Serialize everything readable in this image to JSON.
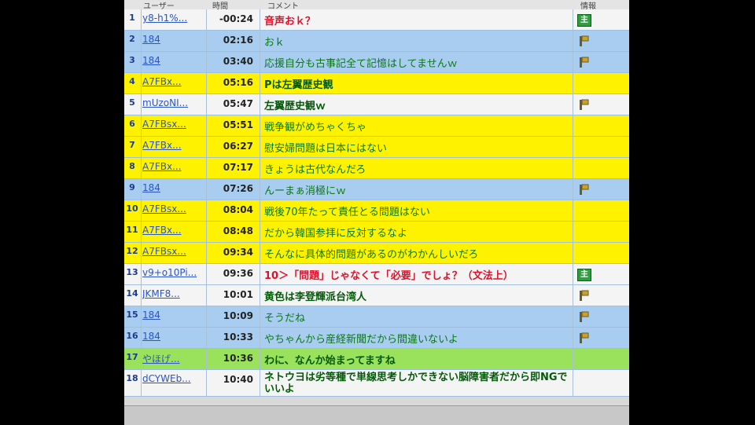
{
  "header": {
    "col_user": "ユーザー",
    "col_time": "時間",
    "col_comment": "コメント",
    "col_info": "情報"
  },
  "colors": {
    "row_white": "#f4f4f4",
    "row_blue": "#a9cdf1",
    "row_yellow": "#fff200",
    "row_green": "#9be25c",
    "text_red": "#e0102a",
    "text_green": "#0a7a12",
    "text_darkgreen": "#055a0a"
  },
  "comments": [
    {
      "num": "1",
      "user": "y8-h1%...",
      "time": "-00:24",
      "text": "音声おｋ？",
      "bg": "white",
      "color": "red",
      "icon": "owner"
    },
    {
      "num": "2",
      "user": "184",
      "time": "02:16",
      "text": "おｋ",
      "bg": "blue",
      "color": "green",
      "icon": "premium"
    },
    {
      "num": "3",
      "user": "184",
      "time": "03:40",
      "text": "応援自分も古事記全て記憶はしてませんｗ",
      "bg": "blue",
      "color": "green",
      "icon": "premium"
    },
    {
      "num": "4",
      "user": "A7FBx...",
      "time": "05:16",
      "text": "Pは左翼歴史観",
      "bg": "yellow",
      "color": "darkgreen",
      "icon": ""
    },
    {
      "num": "5",
      "user": "mUzoNI...",
      "time": "05:47",
      "text": "左翼歴史観ｗ",
      "bg": "white",
      "color": "darkgreen",
      "icon": "premium"
    },
    {
      "num": "6",
      "user": "A7FBsx...",
      "time": "05:51",
      "text": "戦争観がめちゃくちゃ",
      "bg": "yellow",
      "color": "green",
      "icon": ""
    },
    {
      "num": "7",
      "user": "A7FBx...",
      "time": "06:27",
      "text": "慰安婦問題は日本にはない",
      "bg": "yellow",
      "color": "green",
      "icon": ""
    },
    {
      "num": "8",
      "user": "A7FBx...",
      "time": "07:17",
      "text": "きょうは古代なんだろ",
      "bg": "yellow",
      "color": "green",
      "icon": ""
    },
    {
      "num": "9",
      "user": "184",
      "time": "07:26",
      "text": "んーまぁ消極にｗ",
      "bg": "blue",
      "color": "green",
      "icon": "premium"
    },
    {
      "num": "10",
      "user": "A7FBsx...",
      "time": "08:04",
      "text": "戦後70年たって責任とる問題はない",
      "bg": "yellow",
      "color": "green",
      "icon": ""
    },
    {
      "num": "11",
      "user": "A7FBx...",
      "time": "08:48",
      "text": "だから韓国参拝に反対するなよ",
      "bg": "yellow",
      "color": "green",
      "icon": ""
    },
    {
      "num": "12",
      "user": "A7FBsx...",
      "time": "09:34",
      "text": "そんなに具体的問題があるのがわかんしいだろ",
      "bg": "yellow",
      "color": "green",
      "icon": ""
    },
    {
      "num": "13",
      "user": "v9+o10Pi...",
      "time": "09:36",
      "text": "10＞「問題」じゃなくて「必要」でしょ？（文法上）",
      "bg": "white",
      "color": "red",
      "icon": "owner"
    },
    {
      "num": "14",
      "user": "JKMF8...",
      "time": "10:01",
      "text": "黄色は李登輝派台湾人",
      "bg": "white",
      "color": "darkgreen",
      "icon": "premium"
    },
    {
      "num": "15",
      "user": "184",
      "time": "10:09",
      "text": "そうだね",
      "bg": "blue",
      "color": "green",
      "icon": "premium"
    },
    {
      "num": "16",
      "user": "184",
      "time": "10:33",
      "text": "やちゃんから産経新聞だから間違いないよ",
      "bg": "blue",
      "color": "green",
      "icon": "premium"
    },
    {
      "num": "17",
      "user": "やほげ...",
      "time": "10:36",
      "text": "わに、なんか始まってますね",
      "bg": "green",
      "color": "darkgreen",
      "icon": ""
    },
    {
      "num": "18",
      "user": "dCYWEb...",
      "time": "10:40",
      "text": "ネトウヨは劣等種で単線思考しかできない脳障害者だから即NGでいいよ",
      "bg": "white",
      "color": "darkgreen",
      "icon": ""
    }
  ],
  "icons": {
    "owner_label": "主"
  }
}
